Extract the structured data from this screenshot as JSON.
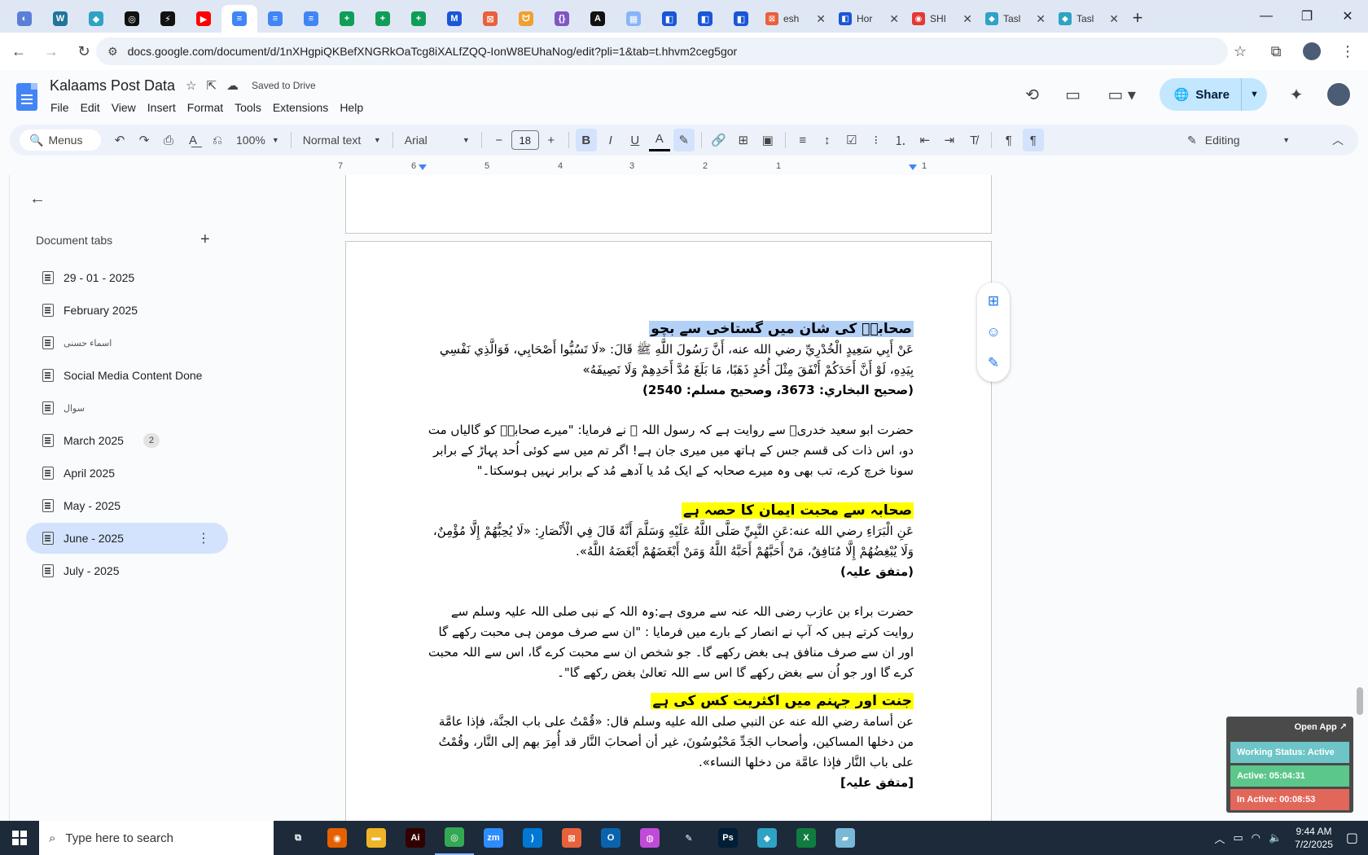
{
  "browser": {
    "tabs_favicons": [
      {
        "icon": "app-icon",
        "color": "#5b7fd8",
        "glyph": "◐"
      },
      {
        "icon": "wordpress-icon",
        "color": "#21759b",
        "glyph": "W"
      },
      {
        "icon": "app-icon",
        "color": "#2fa3c4",
        "glyph": "◆"
      },
      {
        "icon": "openai-icon",
        "color": "#111111",
        "glyph": "◎"
      },
      {
        "icon": "bolt-icon",
        "color": "#111111",
        "glyph": "⚡"
      },
      {
        "icon": "youtube-icon",
        "color": "#ff0000",
        "glyph": "▶"
      },
      {
        "icon": "google-docs-icon",
        "color": "#4285f4",
        "glyph": "≡",
        "active": true
      },
      {
        "icon": "google-docs-icon",
        "color": "#4285f4",
        "glyph": "≡"
      },
      {
        "icon": "google-docs-icon",
        "color": "#4285f4",
        "glyph": "≡"
      },
      {
        "icon": "google-sheets-icon",
        "color": "#0f9d58",
        "glyph": "+"
      },
      {
        "icon": "google-sheets-icon",
        "color": "#0f9d58",
        "glyph": "+"
      },
      {
        "icon": "google-sheets-icon",
        "color": "#0f9d58",
        "glyph": "+"
      },
      {
        "icon": "app-icon",
        "color": "#1a56d6",
        "glyph": "M"
      },
      {
        "icon": "app-icon",
        "color": "#e8613b",
        "glyph": "⊠"
      },
      {
        "icon": "app-icon",
        "color": "#f0a030",
        "glyph": "ᗢ"
      },
      {
        "icon": "code-icon",
        "color": "#7e57c2",
        "glyph": "{}"
      },
      {
        "icon": "app-icon",
        "color": "#111111",
        "glyph": "A"
      },
      {
        "icon": "app-icon",
        "color": "#8ab4f8",
        "glyph": "▦"
      },
      {
        "icon": "app-icon",
        "color": "#1a56d6",
        "glyph": "◧"
      },
      {
        "icon": "app-icon",
        "color": "#1a56d6",
        "glyph": "◧"
      },
      {
        "icon": "app-icon",
        "color": "#1a56d6",
        "glyph": "◧"
      }
    ],
    "tabs_titled": [
      {
        "title": "esh",
        "icon": "app-icon",
        "color": "#e8613b",
        "glyph": "⊠"
      },
      {
        "title": "Hor",
        "icon": "app-icon",
        "color": "#1a56d6",
        "glyph": "◧"
      },
      {
        "title": "SHI",
        "icon": "app-icon",
        "color": "#e53935",
        "glyph": "◉"
      },
      {
        "title": "Tasl",
        "icon": "app-icon",
        "color": "#2fa3c4",
        "glyph": "◆"
      },
      {
        "title": "Tasl",
        "icon": "app-icon",
        "color": "#2fa3c4",
        "glyph": "◆"
      }
    ],
    "url": "docs.google.com/document/d/1nXHgpiQKBefXNGRkOaTcg8iXALfZQQ-IonW8EUhaNog/edit?pli=1&tab=t.hhvm2ceg5gor"
  },
  "docs": {
    "title": "Kalaams Post Data",
    "saved_status": "Saved to Drive",
    "menu": [
      "File",
      "Edit",
      "View",
      "Insert",
      "Format",
      "Tools",
      "Extensions",
      "Help"
    ],
    "share_label": "Share",
    "toolbar": {
      "menus_label": "Menus",
      "zoom": "100%",
      "style": "Normal text",
      "font": "Arial",
      "font_size": "18",
      "mode": "Editing"
    },
    "ruler": [
      "7",
      "6",
      "5",
      "4",
      "3",
      "2",
      "1",
      "1"
    ]
  },
  "sidebar": {
    "heading": "Document tabs",
    "tabs": [
      {
        "label": "29 - 01 - 2025"
      },
      {
        "label": "February 2025"
      },
      {
        "label": "اسماء حسنی",
        "small": true
      },
      {
        "label": "Social Media Content Done"
      },
      {
        "label": "سوال",
        "small": true
      },
      {
        "label": "March 2025",
        "badge": "2"
      },
      {
        "label": "April 2025"
      },
      {
        "label": "May - 2025"
      },
      {
        "label": "June - 2025",
        "selected": true
      },
      {
        "label": "July - 2025"
      }
    ]
  },
  "document": {
    "heading1": "صحابہؓ کی شان میں گستاخی سے بچو",
    "arabic1": "عَنْ أَبِي سَعِيدٍ الْخُدْرِيِّ رضي الله عنه، أَنَّ رَسُولَ اللَّهِ ﷺ قَالَ: «لَا تَسُبُّوا أَصْحَابِي، فَوَالَّذِي نَفْسِي بِيَدِهِ، لَوْ أَنَّ أَحَدَكُمْ أَنْفَقَ مِثْلَ أُحُدٍ ذَهَبًا، مَا بَلَغَ مُدَّ أَحَدِهِمْ وَلَا نَصِيفَهُ»",
    "ref1": "(صحیح البخاري: 3673، وصحیح مسلم: 2540)",
    "urdu1": "حضرت ابو سعید خدریؓ سے روایت ہے کہ رسول اللہ ﷺ نے فرمایا: \"میرے صحابہؓ کو گالیاں مت دو، اس ذات کی قسم جس کے ہاتھ میں میری جان ہے! اگر تم میں سے کوئی اُحد پہاڑ کے برابر سونا خرچ کرے، تب بھی وہ میرے صحابہ کے ایک مُد یا آدھے مُد کے برابر نہیں ہوسکتا۔\"",
    "heading2": "صحابہ سے محبت ایمان کا حصہ ہے",
    "arabic2": "عَنِ الْبَرَاءِ رضي الله عنه:عَنِ النَّبِيِّ صَلَّى اللَّهُ عَلَيْهِ وَسَلَّمَ أَنَّهُ قَالَ فِي الْأَنْصَارِ: «لَا يُحِبُّهُمْ إِلَّا مُؤْمِنٌ، وَلَا يُبْغِضُهُمْ إِلَّا مُنَافِقٌ، مَنْ أَحَبَّهُمْ أَحَبَّهُ اللَّهُ وَمَنْ أَبْغَضَهُمْ أَبْغَضَهُ اللَّهُ».",
    "ref2": "(متفق علیہ)",
    "urdu2": "حضرت براء بن عازب رضی اللہ عنہ سے مروی ہے:وہ اللہ کے نبی صلی اللہ علیہ وسلم سے روایت کرتے ہیں کہ آپ نے انصار کے بارے میں فرمایا : \"ان سے صرف مومن ہی محبت رکھے گا اور ان سے صرف منافق ہی بغض رکھے گا۔ جو شخص ان سے محبت کرے گا، اس سے اللہ محبت کرے گا اور جو اُن سے بغض رکھے گا اس سے اللہ تعالیٰ بغض رکھے گا\"۔",
    "heading3": "جنت اور جہنم میں اکثریت کس کی ہے",
    "arabic3": "عن أسامة رضي الله عنه عن النبي صلى الله عليه وسلم قال: «قُمْتُ على باب الجنَّة، فإذا عامَّة من دخلها المساكين، وأصحاب الجَدِّ مَحْبُوسُونَ، غير أن أصحابَ النَّار قد أُمِرَ بهم إلى النَّار، وقُمْتُ على باب النَّار فإذا عامَّة من دخلها النساء».",
    "ref3": "[متفق علیہ]"
  },
  "tracker": {
    "open_label": "Open App ↗",
    "status": "Working Status: Active",
    "active": "Active: 05:04:31",
    "inactive": "In Active: 00:08:53",
    "colors": {
      "status": "#6ec5c8",
      "active": "#5cc78a",
      "inactive": "#e2675b"
    }
  },
  "taskbar": {
    "search_placeholder": "Type here to search",
    "time": "9:44 AM",
    "date": "7/2/2025",
    "apps": [
      {
        "icon": "task-view-icon",
        "color": "#1c2a3a",
        "glyph": "⧉"
      },
      {
        "icon": "firefox-icon",
        "color": "#e66000",
        "glyph": "◉"
      },
      {
        "icon": "file-explorer-icon",
        "color": "#f0b429",
        "glyph": "▬"
      },
      {
        "icon": "illustrator-icon",
        "color": "#330000",
        "glyph": "Ai"
      },
      {
        "icon": "chrome-icon",
        "color": "#34a853",
        "glyph": "◎",
        "running": true
      },
      {
        "icon": "zoom-icon",
        "color": "#2d8cff",
        "glyph": "zm"
      },
      {
        "icon": "vscode-icon",
        "color": "#0078d4",
        "glyph": "⟩"
      },
      {
        "icon": "app-icon",
        "color": "#e8613b",
        "glyph": "⊠"
      },
      {
        "icon": "outlook-icon",
        "color": "#0a64ad",
        "glyph": "O"
      },
      {
        "icon": "app-icon",
        "color": "#c04bd6",
        "glyph": "◍"
      },
      {
        "icon": "pen-icon",
        "color": "#1c2a3a",
        "glyph": "✎"
      },
      {
        "icon": "photoshop-icon",
        "color": "#001e36",
        "glyph": "Ps"
      },
      {
        "icon": "app-icon",
        "color": "#2fa3c4",
        "glyph": "◆"
      },
      {
        "icon": "excel-icon",
        "color": "#107c41",
        "glyph": "X"
      },
      {
        "icon": "app-icon",
        "color": "#7ab8d8",
        "glyph": "▰"
      }
    ]
  }
}
